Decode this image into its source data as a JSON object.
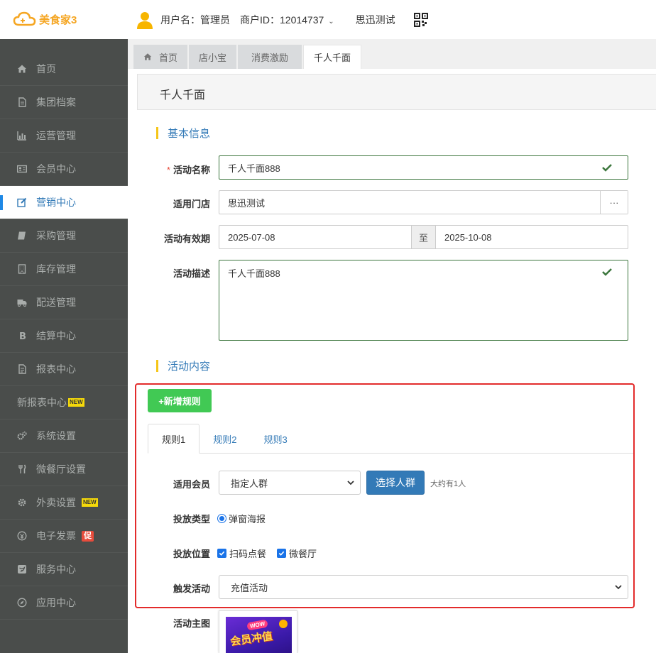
{
  "header": {
    "logo_text": "美食家3",
    "user_label": "用户名：管理员",
    "merchant_label": "商户ID：12014737",
    "store_name": "思迅测试"
  },
  "sidebar": {
    "items": [
      {
        "label": "首页",
        "icon": "home-icon"
      },
      {
        "label": "集团档案",
        "icon": "file-icon"
      },
      {
        "label": "运营管理",
        "icon": "bar-chart-icon"
      },
      {
        "label": "会员中心",
        "icon": "id-card-icon"
      },
      {
        "label": "营销中心",
        "icon": "edit-icon"
      },
      {
        "label": "采购管理",
        "icon": "book-icon"
      },
      {
        "label": "库存管理",
        "icon": "building-icon"
      },
      {
        "label": "配送管理",
        "icon": "truck-icon"
      },
      {
        "label": "结算中心",
        "icon": "bitcoin-icon"
      },
      {
        "label": "报表中心",
        "icon": "report-icon"
      },
      {
        "label": "新报表中心",
        "badge": "NEW"
      },
      {
        "label": "系统设置",
        "icon": "gears-icon"
      },
      {
        "label": "微餐厅设置",
        "icon": "cutlery-icon"
      },
      {
        "label": "外卖设置",
        "icon": "gear-icon",
        "badge": "NEW"
      },
      {
        "label": "电子发票",
        "icon": "invoice-icon",
        "promo": "促"
      },
      {
        "label": "服务中心",
        "icon": "service-icon"
      },
      {
        "label": "应用中心",
        "icon": "compass-icon"
      }
    ]
  },
  "tabs": [
    {
      "label": "首页"
    },
    {
      "label": "店小宝"
    },
    {
      "label": "消费激励"
    },
    {
      "label": "千人千面"
    }
  ],
  "page": {
    "title": "千人千面"
  },
  "basic": {
    "section_title": "基本信息",
    "name_label": "活动名称",
    "required_mark": "*",
    "name_value": "千人千面888",
    "store_label": "适用门店",
    "store_value": "思迅测试",
    "store_addon": "···",
    "period_label": "活动有效期",
    "start_date": "2025-07-08",
    "to_label": "至",
    "end_date": "2025-10-08",
    "desc_label": "活动描述",
    "desc_value": "千人千面888"
  },
  "content": {
    "section_title": "活动内容",
    "add_rule_label": "+新增规则",
    "rule_tabs": [
      "规则1",
      "规则2",
      "规则3"
    ],
    "member_label": "适用会员",
    "member_value": "指定人群",
    "pick_crowd_label": "选择人群",
    "crowd_hint": "大约有1人",
    "type_label": "投放类型",
    "type_option": "弹窗海报",
    "position_label": "投放位置",
    "position_options": [
      "扫码点餐",
      "微餐厅"
    ],
    "trigger_label": "触发活动",
    "trigger_value": "充值活动",
    "poster_label": "活动主图",
    "poster_wow": "WOW",
    "poster_text": "会员冲值"
  }
}
